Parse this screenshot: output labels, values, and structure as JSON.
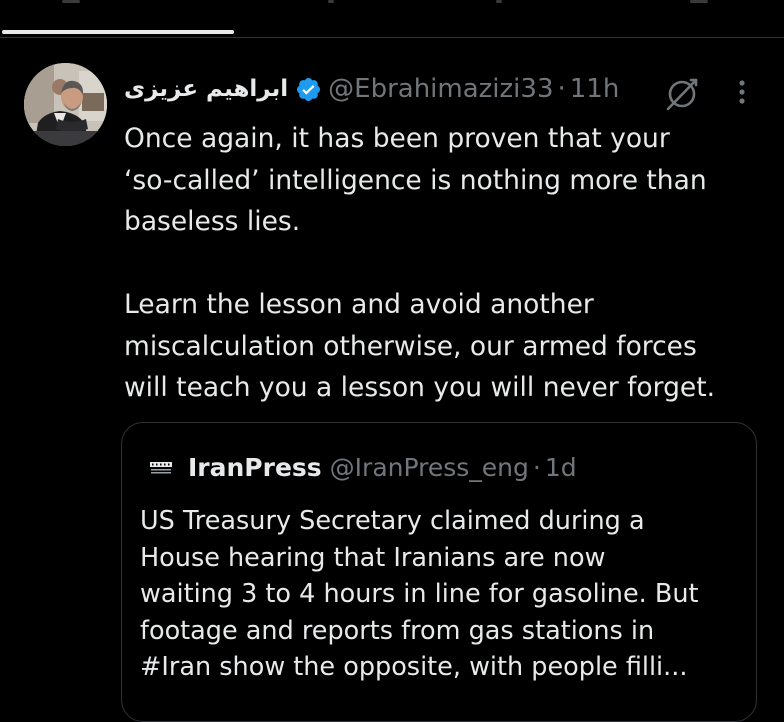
{
  "colors": {
    "background": "#000000",
    "text_primary": "#e7e9ea",
    "text_secondary": "#71767b",
    "divider": "#2f3336",
    "verified_badge": "#1d9bf0",
    "tab_indicator": "#e7e9ea"
  },
  "tweet": {
    "display_name": "ابراهیم عزیزی",
    "handle": "@Ebrahimazizi33",
    "separator": "·",
    "timestamp": "11h",
    "verified": true,
    "avatar": "avatar-photo",
    "actions": {
      "grok_icon": "grok-icon",
      "more_icon": "more-vertical-icon"
    },
    "paragraph_1": "Once again, it has been proven that your\n‘so-called’ intelligence is nothing more than\nbaseless lies.",
    "paragraph_2": "Learn the lesson and avoid another\nmiscalculation otherwise, our armed forces\nwill teach you a lesson you will never forget."
  },
  "quoted_tweet": {
    "display_name": "IranPress",
    "handle": "@IranPress_eng",
    "separator": "·",
    "timestamp": "1d",
    "avatar": "iranpress-logo",
    "text": "US Treasury Secretary claimed during a\nHouse hearing that Iranians are now\nwaiting 3 to 4 hours in line for gasoline. But\nfootage and reports from gas stations in\n#Iran show the opposite, with people filli..."
  }
}
